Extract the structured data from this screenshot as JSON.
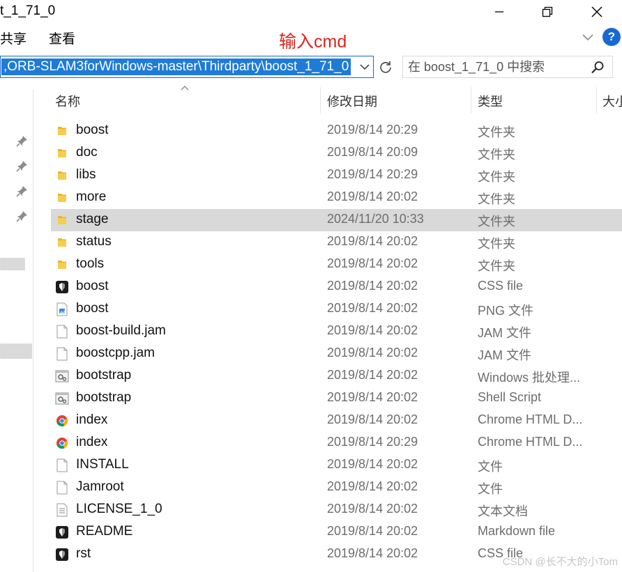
{
  "window": {
    "title": "t_1_71_0"
  },
  "ribbon": {
    "tabs": [
      "共享",
      "查看"
    ],
    "help_label": "?"
  },
  "annotation": "输入cmd",
  "address_bar": {
    "path": ",ORB-SLAM3forWindows-master\\Thirdparty\\boost_1_71_0"
  },
  "search": {
    "placeholder": "在 boost_1_71_0 中搜索"
  },
  "columns": {
    "name": "名称",
    "date": "修改日期",
    "type": "类型",
    "size": "大小"
  },
  "files": [
    {
      "name": "boost",
      "date": "2019/8/14 20:29",
      "type": "文件夹",
      "icon": "folder-icon"
    },
    {
      "name": "doc",
      "date": "2019/8/14 20:09",
      "type": "文件夹",
      "icon": "folder-icon"
    },
    {
      "name": "libs",
      "date": "2019/8/14 20:29",
      "type": "文件夹",
      "icon": "folder-icon"
    },
    {
      "name": "more",
      "date": "2019/8/14 20:02",
      "type": "文件夹",
      "icon": "folder-icon"
    },
    {
      "name": "stage",
      "date": "2024/11/20 10:33",
      "type": "文件夹",
      "icon": "folder-icon",
      "selected": true
    },
    {
      "name": "status",
      "date": "2019/8/14 20:02",
      "type": "文件夹",
      "icon": "folder-icon"
    },
    {
      "name": "tools",
      "date": "2019/8/14 20:02",
      "type": "文件夹",
      "icon": "folder-icon"
    },
    {
      "name": "boost",
      "date": "2019/8/14 20:02",
      "type": "CSS file",
      "icon": "css-file-icon"
    },
    {
      "name": "boost",
      "date": "2019/8/14 20:02",
      "type": "PNG 文件",
      "icon": "png-file-icon"
    },
    {
      "name": "boost-build.jam",
      "date": "2019/8/14 20:02",
      "type": "JAM 文件",
      "icon": "blank-file-icon"
    },
    {
      "name": "boostcpp.jam",
      "date": "2019/8/14 20:02",
      "type": "JAM 文件",
      "icon": "blank-file-icon"
    },
    {
      "name": "bootstrap",
      "date": "2019/8/14 20:02",
      "type": "Windows 批处理...",
      "icon": "batch-file-icon"
    },
    {
      "name": "bootstrap",
      "date": "2019/8/14 20:02",
      "type": "Shell Script",
      "icon": "batch-file-icon"
    },
    {
      "name": "index",
      "date": "2019/8/14 20:02",
      "type": "Chrome HTML D...",
      "icon": "chrome-icon"
    },
    {
      "name": "index",
      "date": "2019/8/14 20:29",
      "type": "Chrome HTML D...",
      "icon": "chrome-icon"
    },
    {
      "name": "INSTALL",
      "date": "2019/8/14 20:02",
      "type": "文件",
      "icon": "blank-file-icon"
    },
    {
      "name": "Jamroot",
      "date": "2019/8/14 20:02",
      "type": "文件",
      "icon": "blank-file-icon"
    },
    {
      "name": "LICENSE_1_0",
      "date": "2019/8/14 20:02",
      "type": "文本文档",
      "icon": "text-file-icon"
    },
    {
      "name": "README",
      "date": "2019/8/14 20:02",
      "type": "Markdown file",
      "icon": "css-file-icon"
    },
    {
      "name": "rst",
      "date": "2019/8/14 20:02",
      "type": "CSS file",
      "icon": "css-file-icon"
    }
  ],
  "watermark": "CSDN @长不大的小Tom",
  "colors": {
    "accent": "#1769d3",
    "selection": "#d9d9d9",
    "annotation": "#e0221b",
    "folder": "#f4c542"
  }
}
